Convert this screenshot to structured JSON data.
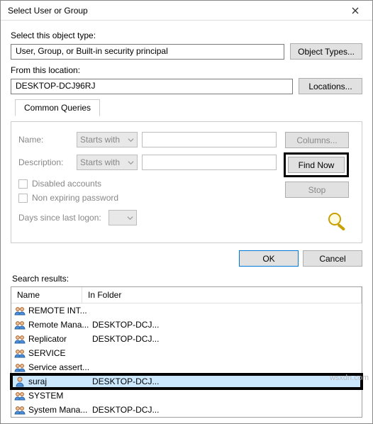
{
  "title": "Select User or Group",
  "labels": {
    "object_type": "Select this object type:",
    "from_location": "From this location:",
    "search_results": "Search results:"
  },
  "object_type_value": "User, Group, or Built-in security principal",
  "location_value": "DESKTOP-DCJ96RJ",
  "buttons": {
    "object_types": "Object Types...",
    "locations": "Locations...",
    "columns": "Columns...",
    "find_now": "Find Now",
    "stop": "Stop",
    "ok": "OK",
    "cancel": "Cancel"
  },
  "tab": "Common Queries",
  "queries": {
    "name_label": "Name:",
    "desc_label": "Description:",
    "starts_with": "Starts with",
    "disabled": "Disabled accounts",
    "nonexpiring": "Non expiring password",
    "days_since": "Days since last logon:"
  },
  "columns": {
    "name": "Name",
    "in_folder": "In Folder"
  },
  "results": [
    {
      "name": "REMOTE INT...",
      "folder": "",
      "type": "group"
    },
    {
      "name": "Remote Mana...",
      "folder": "DESKTOP-DCJ...",
      "type": "group"
    },
    {
      "name": "Replicator",
      "folder": "DESKTOP-DCJ...",
      "type": "group"
    },
    {
      "name": "SERVICE",
      "folder": "",
      "type": "group"
    },
    {
      "name": "Service assert...",
      "folder": "",
      "type": "group"
    },
    {
      "name": "suraj",
      "folder": "DESKTOP-DCJ...",
      "type": "user",
      "selected": true,
      "highlight": true
    },
    {
      "name": "SYSTEM",
      "folder": "",
      "type": "group"
    },
    {
      "name": "System Mana...",
      "folder": "DESKTOP-DCJ...",
      "type": "group"
    }
  ],
  "watermark": "wsxdn.com"
}
